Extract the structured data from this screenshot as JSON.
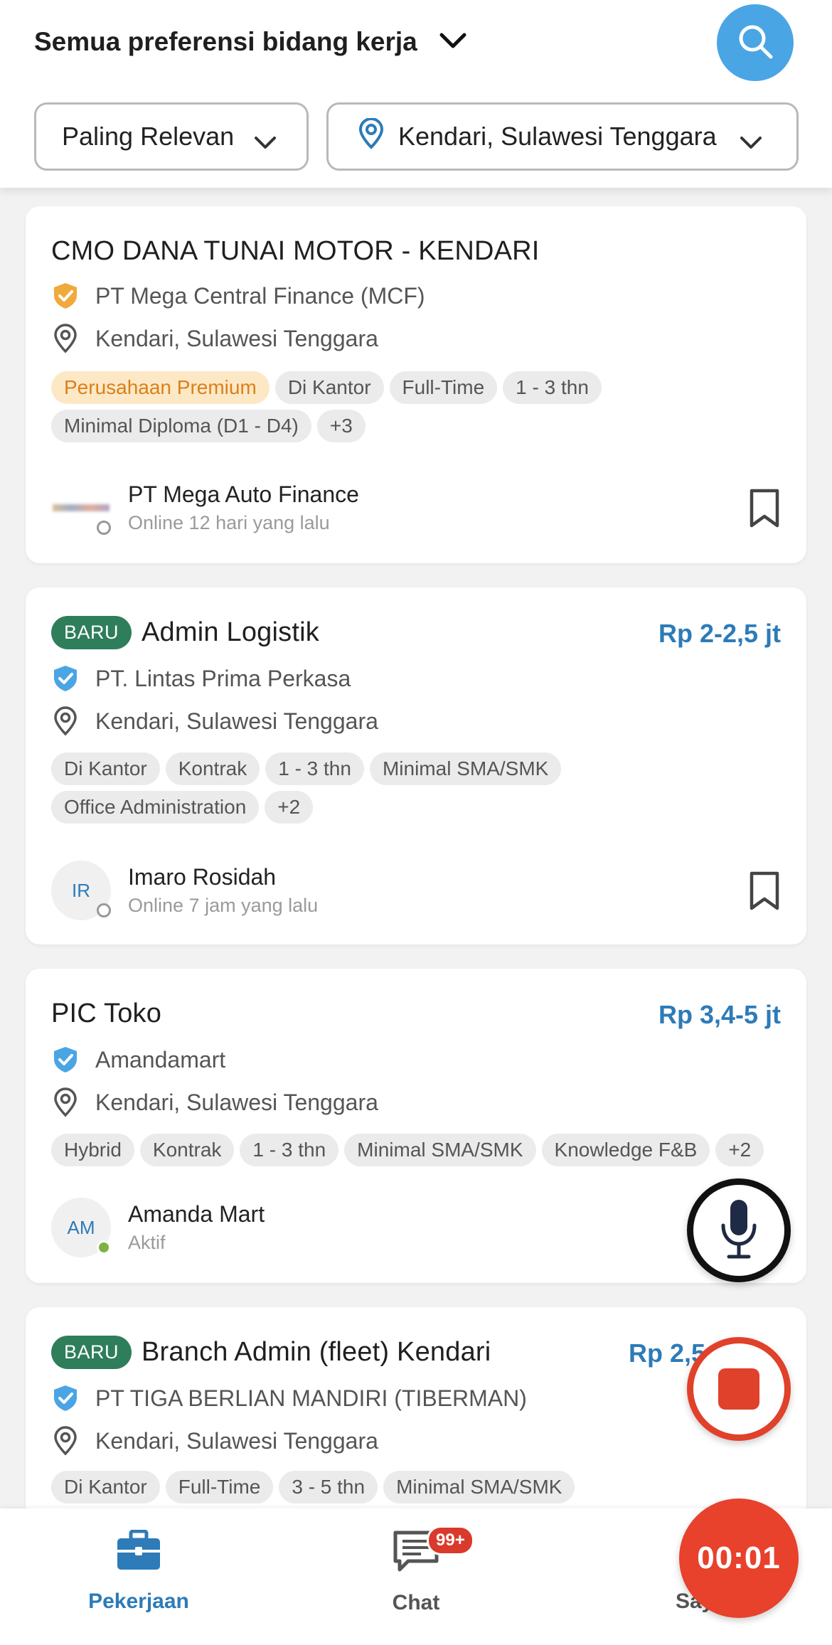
{
  "header": {
    "preference_label": "Semua preferensi bidang kerja",
    "sort_label": "Paling Relevan",
    "location_label": "Kendari, Sulawesi Tenggara"
  },
  "colors": {
    "accent": "#2d7bb8",
    "search": "#4aa5e4",
    "new_badge": "#2e7d5b",
    "record": "#e0412a"
  },
  "jobs": [
    {
      "title": "CMO DANA TUNAI MOTOR - KENDARI",
      "company": "PT Mega Central Finance (MCF)",
      "verified_icon": "shield-check-orange-icon",
      "location": "Kendari, Sulawesi Tenggara",
      "tags": [
        "Perusahaan Premium",
        "Di Kantor",
        "Full-Time",
        "1 - 3 thn",
        "Minimal Diploma (D1 - D4)",
        "+3"
      ],
      "recruiter_name": "PT Mega Auto Finance",
      "recruiter_status": "Online 12 hari yang lalu"
    },
    {
      "badge": "BARU",
      "title": "Admin Logistik",
      "salary": "Rp 2-2,5 jt",
      "company": "PT. Lintas Prima Perkasa",
      "location": "Kendari, Sulawesi Tenggara",
      "tags": [
        "Di Kantor",
        "Kontrak",
        "1 - 3 thn",
        "Minimal SMA/SMK",
        "Office Administration",
        "+2"
      ],
      "recruiter_initials": "IR",
      "recruiter_name": "Imaro Rosidah",
      "recruiter_status": "Online 7 jam yang lalu"
    },
    {
      "title": "PIC Toko",
      "salary": "Rp 3,4-5 jt",
      "company": "Amandamart",
      "location": "Kendari, Sulawesi Tenggara",
      "tags": [
        "Hybrid",
        "Kontrak",
        "1 - 3 thn",
        "Minimal SMA/SMK",
        "Knowledge F&B",
        "+2"
      ],
      "recruiter_initials": "AM",
      "recruiter_name": "Amanda Mart",
      "recruiter_status": "Aktif"
    },
    {
      "badge": "BARU",
      "title": "Branch Admin (fleet) Kendari",
      "salary": "Rp 2,5",
      "company": "PT TIGA BERLIAN MANDIRI (TIBERMAN)",
      "location": "Kendari, Sulawesi Tenggara",
      "tags": [
        "Di Kantor",
        "Full-Time",
        "3 - 5 thn",
        "Minimal SMA/SMK"
      ]
    }
  ],
  "overlay": {
    "timer": "00:01"
  },
  "nav": {
    "jobs_label": "Pekerjaan",
    "chat_label": "Chat",
    "chat_badge": "99+",
    "saya_label": "Saya"
  }
}
